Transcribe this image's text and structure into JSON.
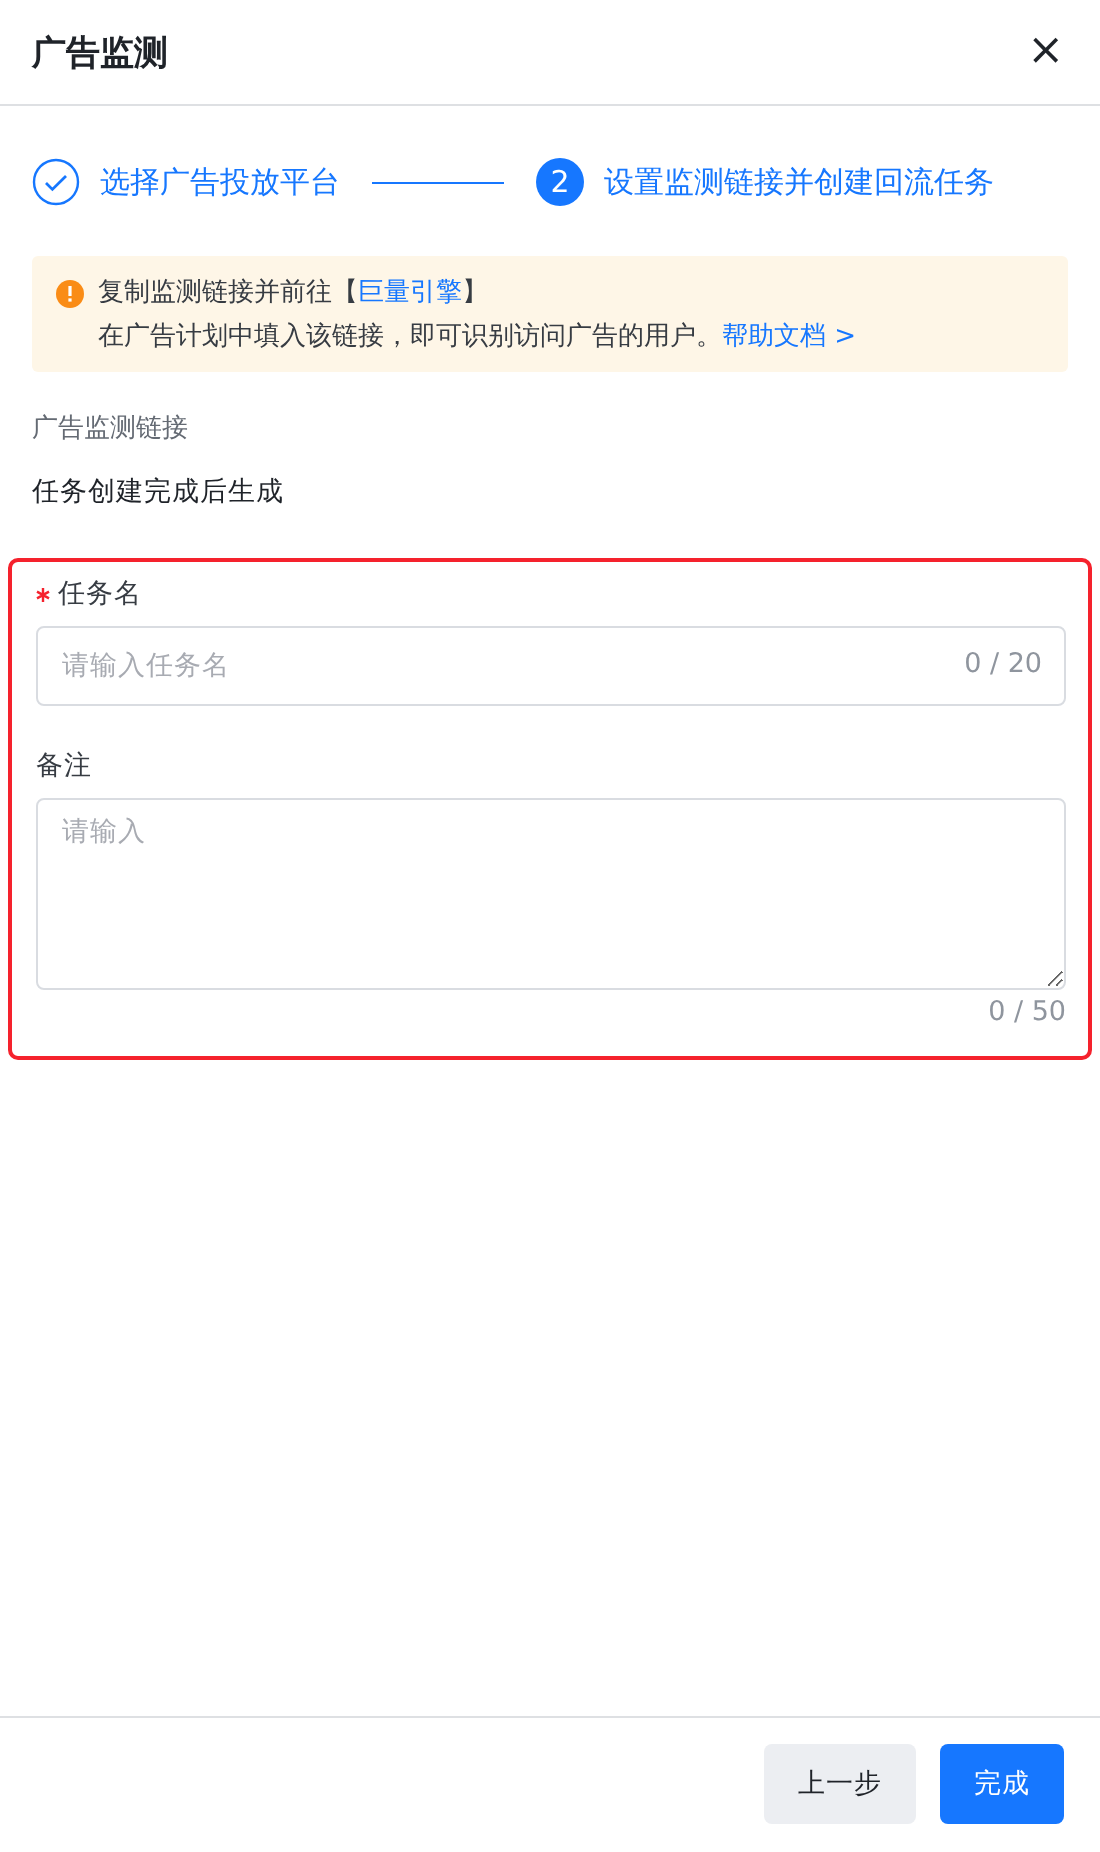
{
  "dialog": {
    "title": "广告监测",
    "close": "×"
  },
  "steps": [
    {
      "label": "选择广告投放平台",
      "completed": true
    },
    {
      "number": "2",
      "label": "设置监测链接并创建回流任务",
      "completed": false
    }
  ],
  "notice": {
    "line1": "复制监测链接并前往【",
    "link1": "巨量引擎",
    "line1_end": "】",
    "line2": "在广告计划中填入该链接，即可识别访问广告的用户。",
    "link2": "帮助文档 >"
  },
  "link_field": {
    "label": "广告监测链接",
    "value": "任务创建完成后生成"
  },
  "highlighted_form": true,
  "fields": [
    {
      "kind": "input",
      "label": "任务名",
      "required": true,
      "placeholder": "请输入任务名",
      "counter": "0 / 20"
    },
    {
      "kind": "textarea",
      "label": "备注",
      "required": false,
      "placeholder": "请输入",
      "counter": "0 / 50"
    }
  ],
  "buttons": [
    {
      "label": "上一步",
      "primary": false
    },
    {
      "label": "完成",
      "primary": true
    }
  ]
}
